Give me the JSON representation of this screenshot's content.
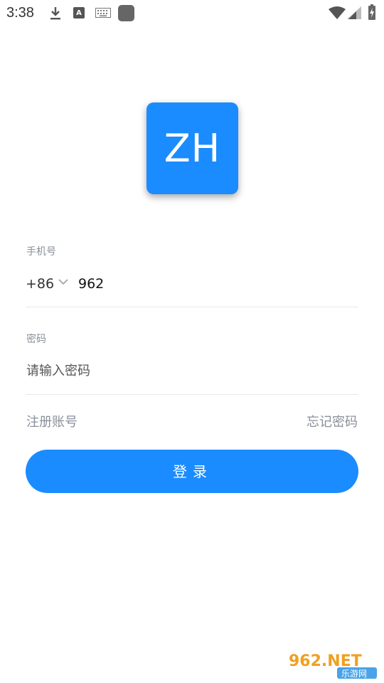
{
  "status_bar": {
    "time": "3:38",
    "icons": [
      "download-icon",
      "text-a-icon",
      "keyboard-icon",
      "app-square-icon",
      "wifi-icon",
      "signal-icon",
      "battery-icon"
    ]
  },
  "logo": {
    "text": "ZH",
    "color": "#1a8cff"
  },
  "phone": {
    "label": "手机号",
    "country_code": "+86",
    "value": "962"
  },
  "password": {
    "label": "密码",
    "placeholder": "请输入密码"
  },
  "links": {
    "register": "注册账号",
    "forgot": "忘记密码"
  },
  "login_button": {
    "label": "登录",
    "color": "#1a8cff"
  },
  "watermark": {
    "brand": "962.NET",
    "subtitle": "乐游网"
  }
}
